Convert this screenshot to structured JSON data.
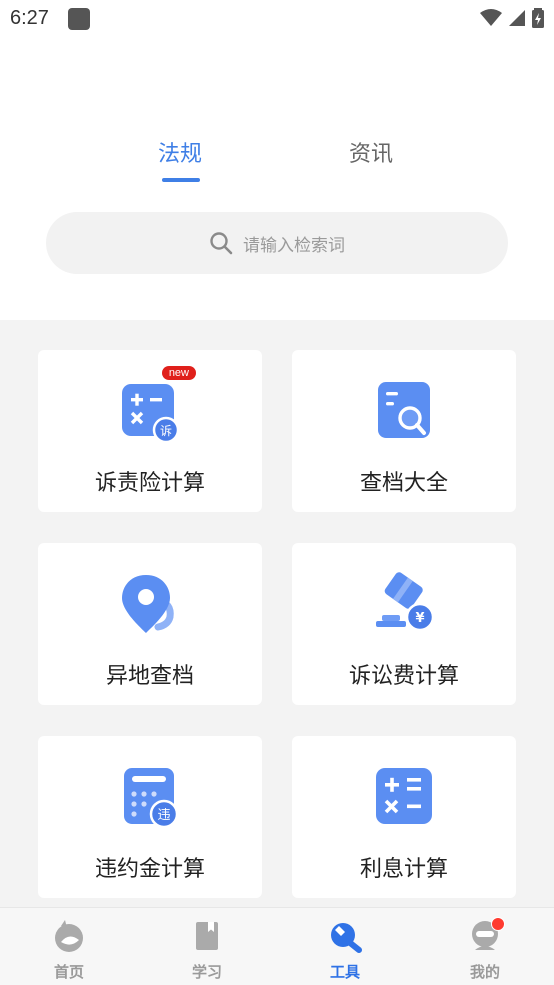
{
  "status": {
    "time": "6:27"
  },
  "tabs": [
    {
      "label": "法规",
      "active": true
    },
    {
      "label": "资讯",
      "active": false
    }
  ],
  "search": {
    "placeholder": "请输入检索词"
  },
  "tools": [
    {
      "label": "诉责险计算",
      "icon": "calculator-su-icon",
      "badge": "new"
    },
    {
      "label": "查档大全",
      "icon": "document-search-icon"
    },
    {
      "label": "异地查档",
      "icon": "location-pin-icon"
    },
    {
      "label": "诉讼费计算",
      "icon": "gavel-yuan-icon"
    },
    {
      "label": "违约金计算",
      "icon": "calculator-wei-icon"
    },
    {
      "label": "利息计算",
      "icon": "calculator-icon"
    }
  ],
  "icon_badges": {
    "su": "诉",
    "wei": "违",
    "yuan": "¥"
  },
  "bottom_nav": [
    {
      "label": "首页",
      "icon": "home-icon",
      "active": false
    },
    {
      "label": "学习",
      "icon": "book-icon",
      "active": false
    },
    {
      "label": "工具",
      "icon": "wrench-icon",
      "active": true
    },
    {
      "label": "我的",
      "icon": "profile-icon",
      "active": false,
      "notification": true
    }
  ],
  "colors": {
    "accent": "#3f7fe6",
    "icon_blue": "#5b8ef2",
    "badge_red": "#e0201b"
  }
}
